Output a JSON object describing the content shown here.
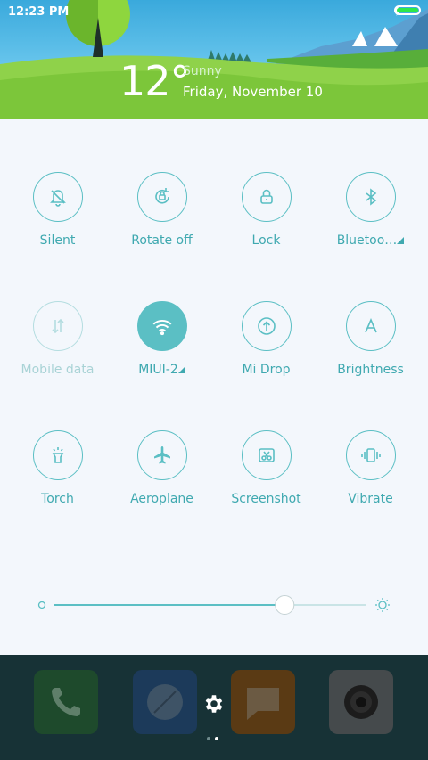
{
  "status_bar": {
    "time": "12:23 PM",
    "battery_level": 1.0
  },
  "weather": {
    "temperature": "12°",
    "condition": "Sunny",
    "date": "Friday, November 10"
  },
  "tiles": [
    {
      "label": "Silent",
      "icon": "bell-off-icon",
      "state": "off"
    },
    {
      "label": "Rotate off",
      "icon": "rotate-lock-icon",
      "state": "off"
    },
    {
      "label": "Lock",
      "icon": "lock-icon",
      "state": "off"
    },
    {
      "label": "Bluetoo…",
      "icon": "bluetooth-icon",
      "state": "off",
      "has_more": true
    },
    {
      "label": "Mobile data",
      "icon": "mobile-data-icon",
      "state": "disabled"
    },
    {
      "label": "MIUI-2",
      "icon": "wifi-icon",
      "state": "on",
      "has_more": true
    },
    {
      "label": "Mi Drop",
      "icon": "mi-drop-icon",
      "state": "off"
    },
    {
      "label": "Brightness",
      "icon": "auto-brightness-icon",
      "state": "off"
    },
    {
      "label": "Torch",
      "icon": "torch-icon",
      "state": "off"
    },
    {
      "label": "Aeroplane",
      "icon": "airplane-icon",
      "state": "off"
    },
    {
      "label": "Screenshot",
      "icon": "screenshot-icon",
      "state": "off"
    },
    {
      "label": "Vibrate",
      "icon": "vibrate-icon",
      "state": "off"
    }
  ],
  "brightness": {
    "level": 0.74
  },
  "dock": {
    "apps": [
      "phone-app",
      "browser-app",
      "messages-app",
      "camera-app"
    ],
    "settings_icon": "gear-icon",
    "page_count": 2,
    "current_page": 2
  },
  "colors": {
    "accent": "#5bbfc4",
    "label": "#3fa9b0",
    "panel_bg": "#f3f7fc",
    "dock_bg": "#173236"
  }
}
